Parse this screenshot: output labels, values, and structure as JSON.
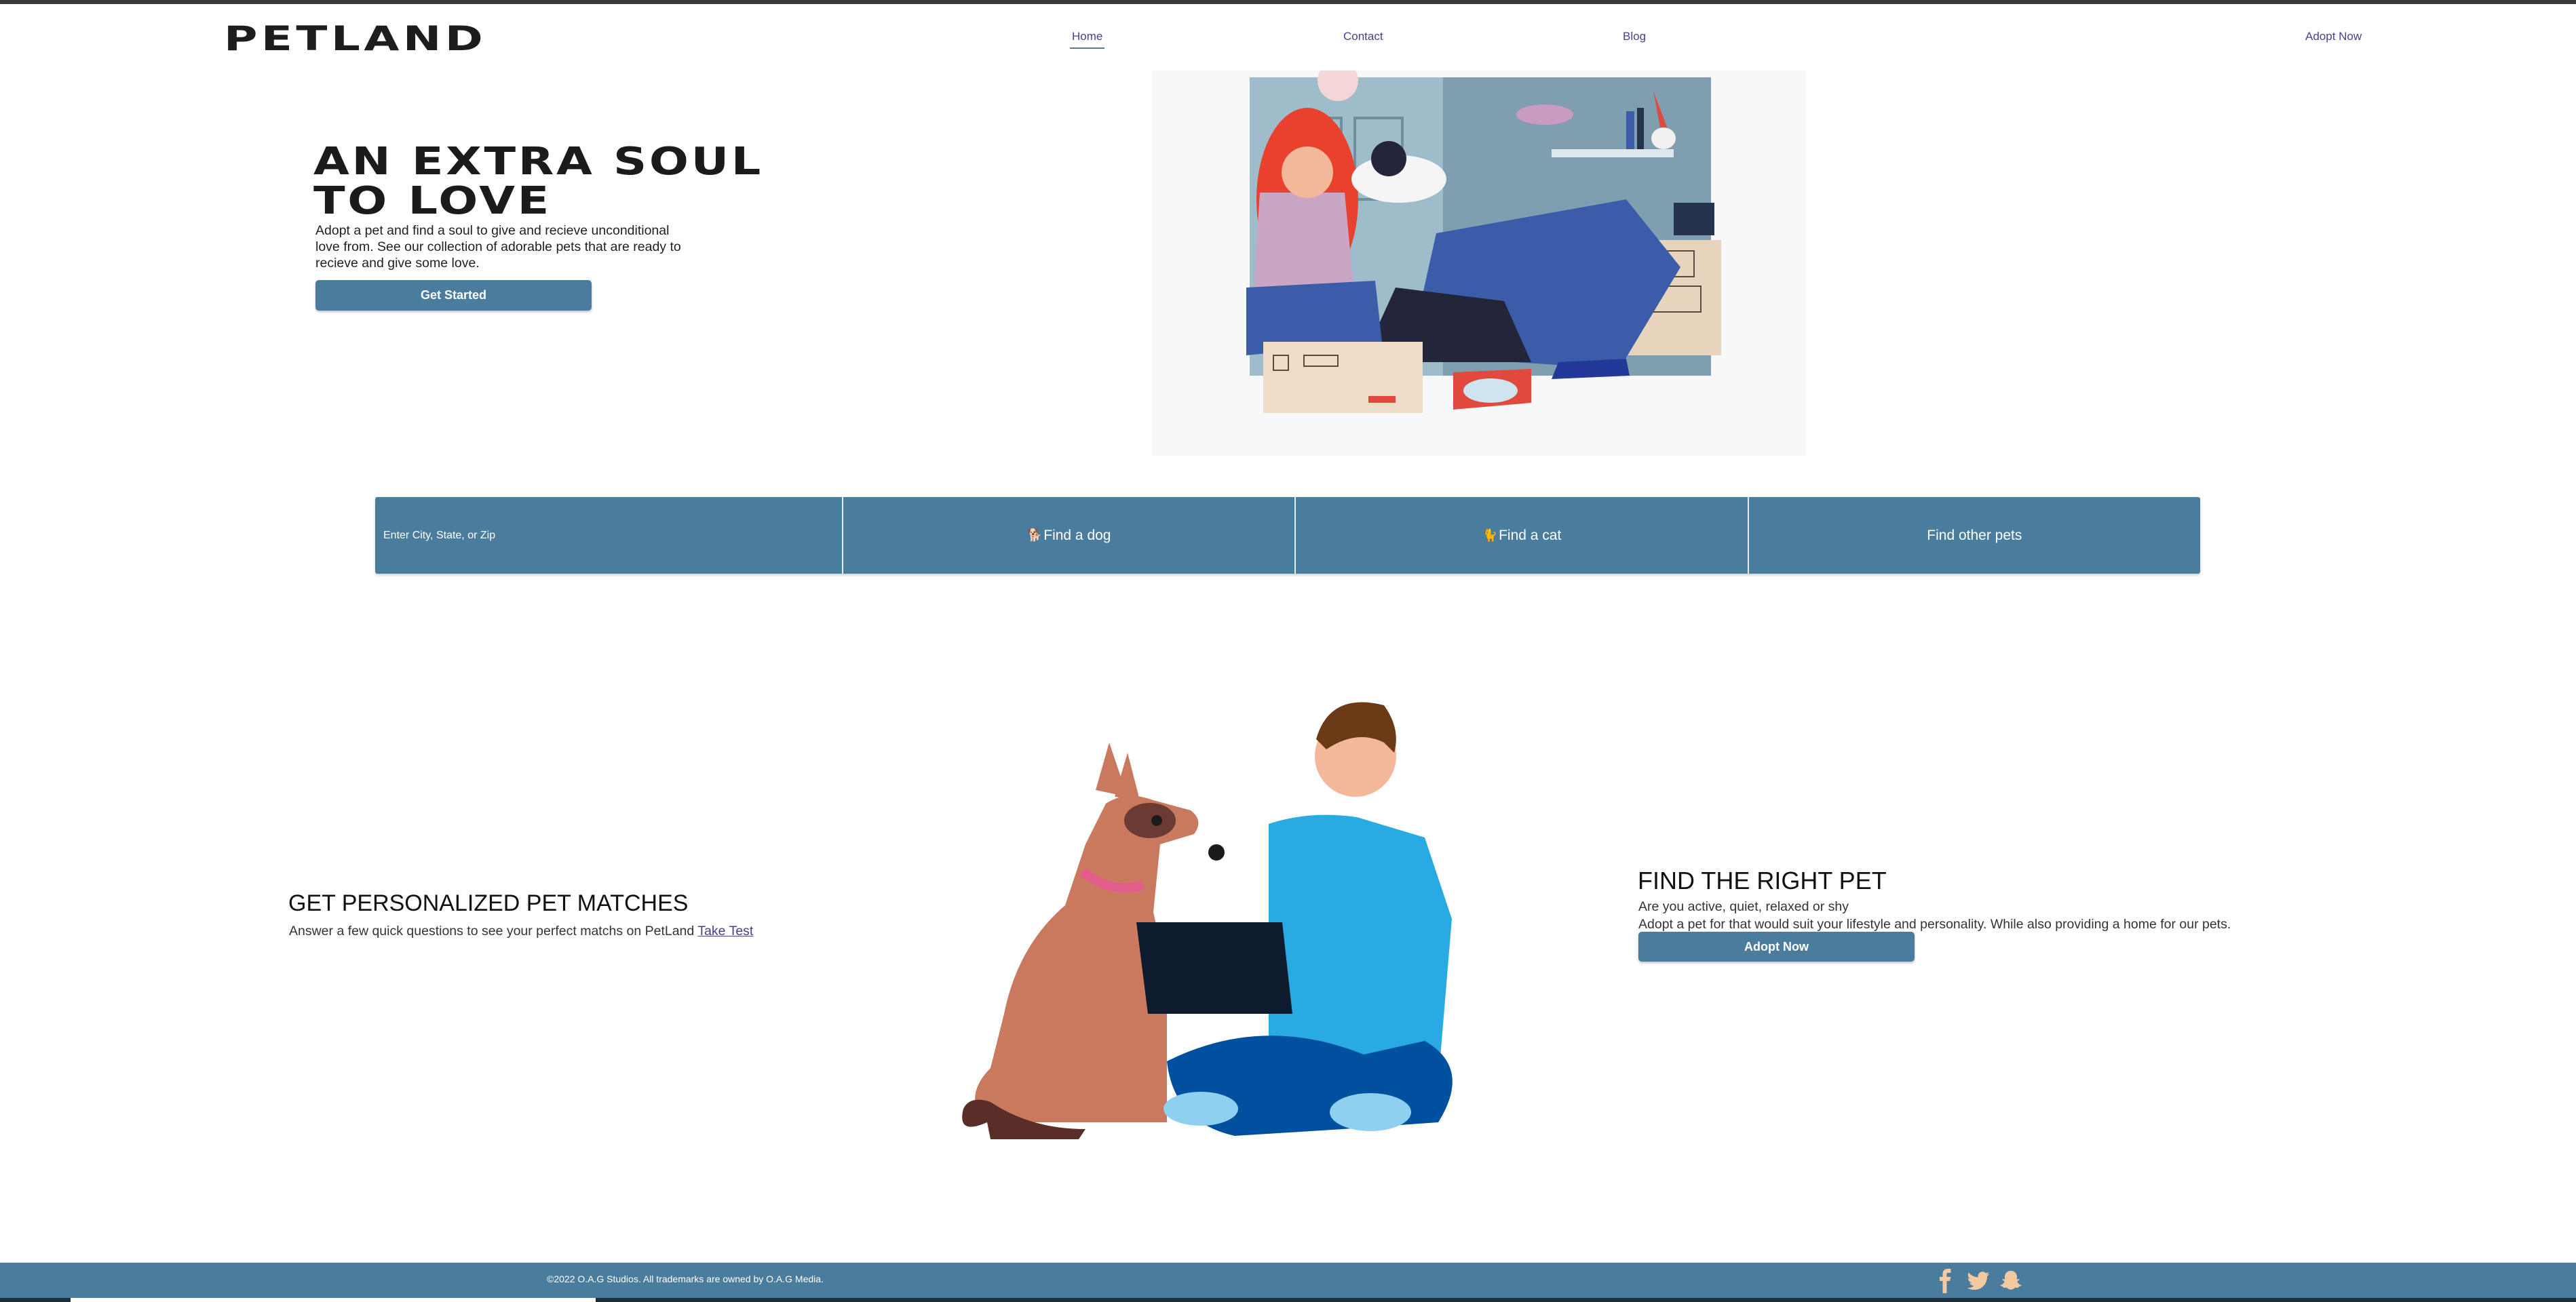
{
  "header": {
    "logo": "PetLand",
    "nav": {
      "home": "Home",
      "contact": "Contact",
      "blog": "Blog",
      "adopt_now": "Adopt Now"
    }
  },
  "hero": {
    "title": "An Extra Soul to Love",
    "subtitle": "Adopt a pet and find a soul to give and recieve unconditional love from. See our collection of adorable pets that are ready to recieve and give some love.",
    "cta_label": "Get Started"
  },
  "search": {
    "placeholder": "Enter City, State, or Zip",
    "find_dog": "Find a dog",
    "find_cat": "Find a cat",
    "find_other": "Find other pets"
  },
  "matches": {
    "title": "Get Personalized Pet Matches",
    "text": "Answer a few quick questions to see your perfect matchs on PetLand",
    "link": "Take Test"
  },
  "right_pet": {
    "title": "Find the Right Pet",
    "line1": "Are you active, quiet, relaxed or shy",
    "line2": "Adopt a pet for that would suit your lifestyle and personality. While also providing a home for our pets.",
    "cta_label": "Adopt Now"
  },
  "footer": {
    "copyright": "©2022 O.A.G Studios. All trademarks are owned by O.A.G Media."
  },
  "colors": {
    "accent": "#4a7d9d",
    "link": "#4a3f8a",
    "footer_icon": "#f3c9a0"
  },
  "icons": [
    "paw-dog-icon",
    "paw-cat-icon",
    "facebook-icon",
    "twitter-icon",
    "snapchat-icon"
  ]
}
